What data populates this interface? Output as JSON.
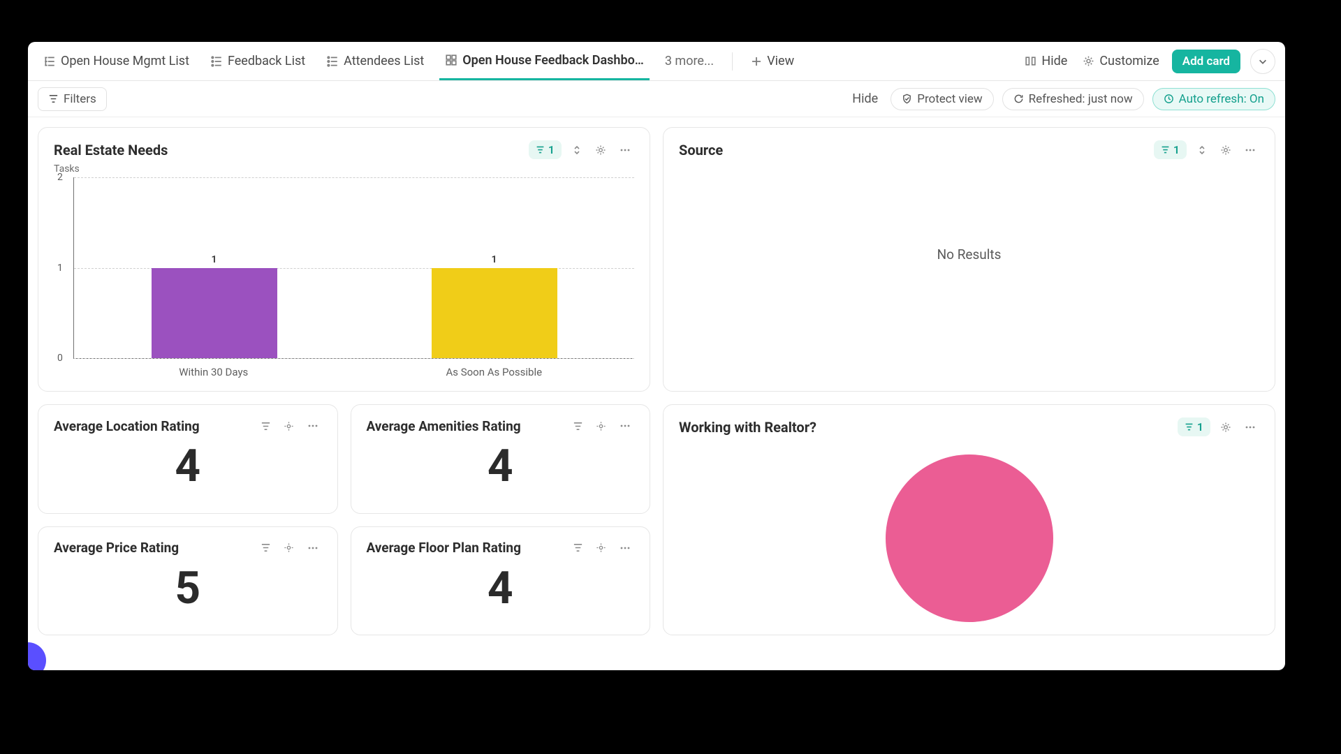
{
  "tabs": [
    {
      "label": "Open House Mgmt List",
      "icon": "hierarchy-list"
    },
    {
      "label": "Feedback List",
      "icon": "list"
    },
    {
      "label": "Attendees List",
      "icon": "list"
    },
    {
      "label": "Open House Feedback Dashbo…",
      "icon": "dashboard",
      "active": true
    }
  ],
  "tabs_more": "3 more...",
  "tabs_add": "View",
  "topbar": {
    "hide": "Hide",
    "customize": "Customize",
    "add_card": "Add card"
  },
  "toolbar": {
    "filters": "Filters",
    "hide": "Hide",
    "protect": "Protect view",
    "refreshed": "Refreshed: just now",
    "autorefresh": "Auto refresh: On"
  },
  "cards": {
    "real_estate_needs": {
      "title": "Real Estate Needs",
      "ylabel": "Tasks",
      "filter": "1"
    },
    "source": {
      "title": "Source",
      "filter": "1",
      "no_results": "No Results"
    },
    "loc": {
      "title": "Average Location Rating",
      "value": "4"
    },
    "amen": {
      "title": "Average Amenities Rating",
      "value": "4"
    },
    "price": {
      "title": "Average Price Rating",
      "value": "5"
    },
    "floor": {
      "title": "Average Floor Plan Rating",
      "value": "4"
    },
    "realtor": {
      "title": "Working with Realtor?",
      "filter": "1"
    }
  },
  "chart_data": {
    "type": "bar",
    "title": "Real Estate Needs",
    "ylabel": "Tasks",
    "ylim": [
      0,
      2
    ],
    "yticks": [
      0,
      1,
      2
    ],
    "categories": [
      "Within 30 Days",
      "As Soon As Possible"
    ],
    "values": [
      1,
      1
    ],
    "colors": [
      "#9b51bf",
      "#f0cd18"
    ]
  }
}
